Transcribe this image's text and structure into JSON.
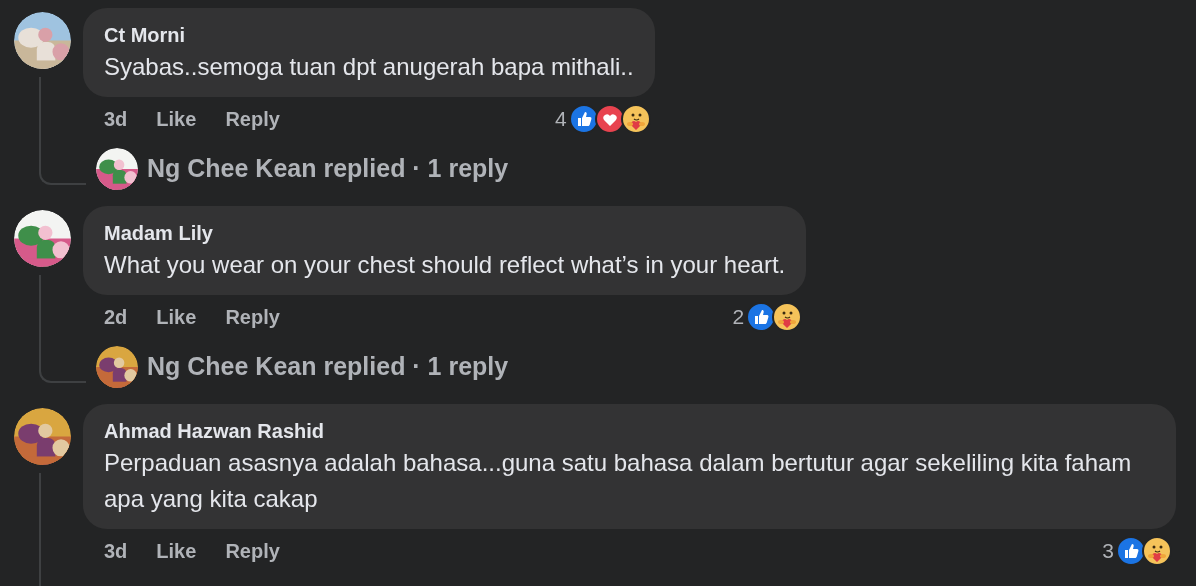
{
  "comments": [
    {
      "author": "Ct Morni",
      "text": "Syabas..semoga tuan dpt anugerah bapa mithali..",
      "time": "3d",
      "like": "Like",
      "reply": "Reply",
      "reaction_count": "4",
      "reactions": [
        {
          "kind": "like"
        },
        {
          "kind": "love"
        },
        {
          "kind": "care"
        }
      ],
      "replies_summary": {
        "text": "Ng Chee Kean replied · 1 reply"
      }
    },
    {
      "author": "Madam Lily",
      "text": "What you wear on your chest should reflect what’s in your heart.",
      "time": "2d",
      "like": "Like",
      "reply": "Reply",
      "reaction_count": "2",
      "reactions": [
        {
          "kind": "like"
        },
        {
          "kind": "care"
        }
      ],
      "replies_summary": {
        "text": "Ng Chee Kean replied · 1 reply"
      }
    },
    {
      "author": "Ahmad Hazwan Rashid",
      "text": "Perpaduan asasnya adalah bahasa...guna satu bahasa dalam bertutur agar sekeliling kita faham apa yang kita cakap",
      "time": "3d",
      "like": "Like",
      "reply": "Reply",
      "reaction_count": "3",
      "reactions": [
        {
          "kind": "like"
        },
        {
          "kind": "care"
        }
      ]
    }
  ]
}
